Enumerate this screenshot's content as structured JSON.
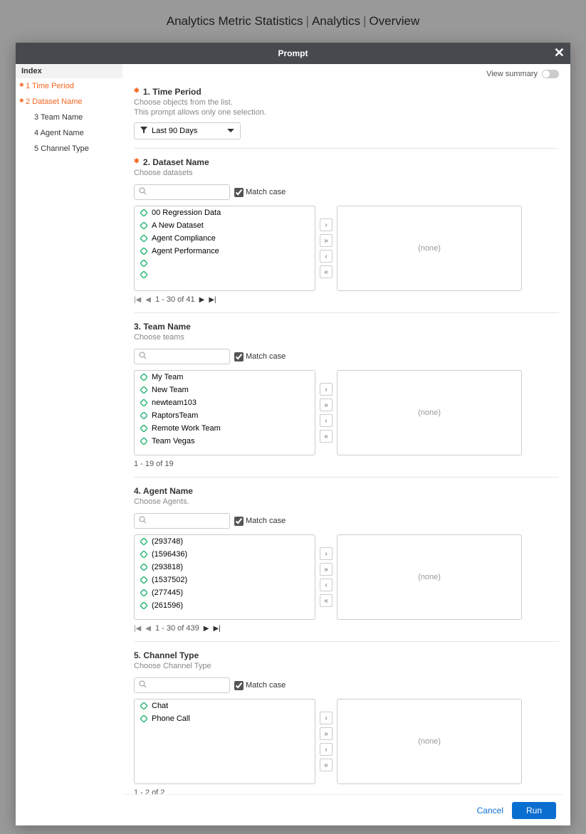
{
  "breadcrumb": {
    "parts": [
      "Analytics Metric Statistics",
      "Analytics",
      "Overview"
    ]
  },
  "modal": {
    "title": "Prompt",
    "view_summary": "View summary",
    "close_label": "Close"
  },
  "sidebar": {
    "title": "Index",
    "items": [
      {
        "label": "1 Time Period",
        "required": true,
        "active": true
      },
      {
        "label": "2 Dataset Name",
        "required": true,
        "active": true
      },
      {
        "label": "3 Team Name",
        "required": false,
        "indent": true
      },
      {
        "label": "4 Agent Name",
        "required": false,
        "indent": true
      },
      {
        "label": "5 Channel Type",
        "required": false,
        "indent": true
      }
    ]
  },
  "sections": {
    "time_period": {
      "num": "1.",
      "title": "Time Period",
      "sub1": "Choose objects from the list.",
      "sub2": "This prompt allows only one selection.",
      "selected": "Last 90 Days"
    },
    "dataset": {
      "num": "2.",
      "title": "Dataset Name",
      "sub": "Choose datasets",
      "match_case": "Match case",
      "items": [
        "00 Regression Data",
        "A New Dataset",
        "Agent Compliance",
        "Agent Performance",
        "",
        ""
      ],
      "target": "(none)",
      "pager": "1 - 30 of 41"
    },
    "team": {
      "num": "3.",
      "title": "Team Name",
      "sub": "Choose teams",
      "match_case": "Match case",
      "items": [
        "My Team",
        "New Team",
        "newteam103",
        "RaptorsTeam",
        "Remote Work Team",
        "Team Vegas"
      ],
      "target": "(none)",
      "pager": "1 - 19 of 19"
    },
    "agent": {
      "num": "4.",
      "title": "Agent Name",
      "sub": "Choose Agents.",
      "match_case": "Match case",
      "items": [
        "(293748)",
        "(1596436)",
        "(293818)",
        "(1537502)",
        "(277445)",
        "(261596)"
      ],
      "target": "(none)",
      "pager": "1 - 30 of 439"
    },
    "channel": {
      "num": "5.",
      "title": "Channel Type",
      "sub": "Choose Channel Type",
      "match_case": "Match case",
      "items": [
        "Chat",
        "Phone Call"
      ],
      "target": "(none)",
      "pager": "1 - 2 of 2"
    }
  },
  "footer": {
    "cancel": "Cancel",
    "run": "Run"
  }
}
